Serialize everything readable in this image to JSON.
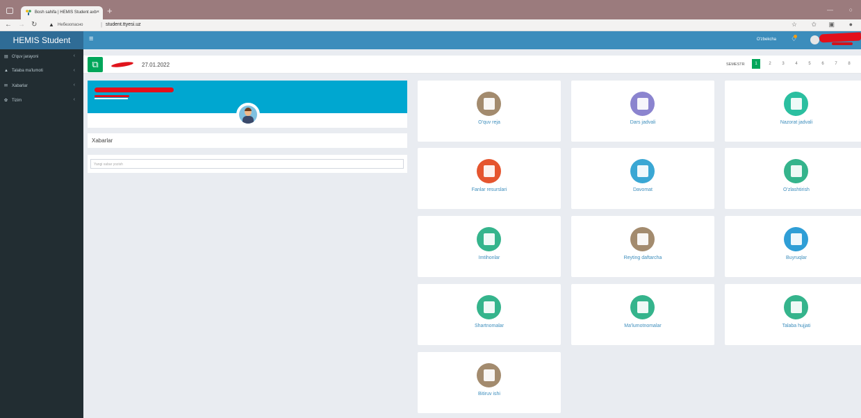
{
  "browser": {
    "tab_title": "Bosh sahifa | HEMIS Student axb",
    "tab_close": "×",
    "new_tab": "+",
    "address_warning": "Небезопасно",
    "url": "student.ttyesi.uz",
    "address_sep": "|"
  },
  "app": {
    "brand": "HEMIS Student",
    "language": "O'zbekcha"
  },
  "sidebar": {
    "items": [
      {
        "label": "O'quv jarayoni",
        "icon": "book-icon"
      },
      {
        "label": "Talaba ma'lumoti",
        "icon": "user-icon"
      },
      {
        "label": "Xabarlar",
        "icon": "envelope-icon"
      },
      {
        "label": "Tizim",
        "icon": "gear-icon"
      }
    ]
  },
  "topbar": {
    "date": "27.01.2022",
    "semester_label": "SEMESTR",
    "semesters": [
      "1",
      "2",
      "3",
      "4",
      "5",
      "6",
      "7",
      "8"
    ],
    "active_semester": "1"
  },
  "news": {
    "title": "Xabarlar",
    "search_placeholder": "Yangi xabar yozish"
  },
  "tiles": [
    {
      "label": "O'quv reja",
      "color": "#a38b6e"
    },
    {
      "label": "Dars jadvali",
      "color": "#8b84cf"
    },
    {
      "label": "Nazorat jadvali",
      "color": "#2bbfa0"
    },
    {
      "label": "Fanlar resurslari",
      "color": "#e5552f"
    },
    {
      "label": "Davomat",
      "color": "#3aa7d4"
    },
    {
      "label": "O'zlashtirish",
      "color": "#35b48c"
    },
    {
      "label": "Imtihonlar",
      "color": "#35b48c"
    },
    {
      "label": "Reyting daftarcha",
      "color": "#a38b6e"
    },
    {
      "label": "Buyruqlar",
      "color": "#2f9ed6"
    },
    {
      "label": "Shartnomalar",
      "color": "#35b48c"
    },
    {
      "label": "Ma'lumotnomalar",
      "color": "#35b48c"
    },
    {
      "label": "Talaba hujjati",
      "color": "#35b48c"
    },
    {
      "label": "Bitiruv ishi",
      "color": "#a38b6e"
    }
  ]
}
